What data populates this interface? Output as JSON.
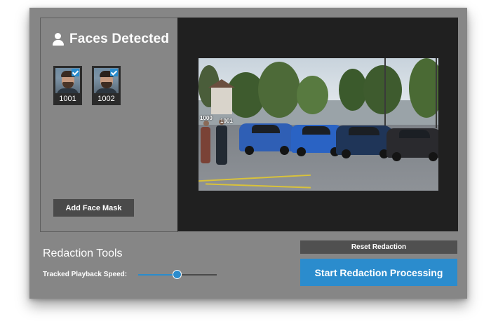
{
  "faces_panel": {
    "title": "Faces Detected",
    "faces": [
      {
        "id": "1001",
        "selected": true
      },
      {
        "id": "1002",
        "selected": true
      }
    ],
    "add_mask_label": "Add Face Mask"
  },
  "video": {
    "overlay_labels": [
      "1000",
      "1001"
    ]
  },
  "tools": {
    "title": "Redaction Tools",
    "speed_label": "Tracked Playback Speed:",
    "speed_value": 0.5,
    "reset_label": "Reset Redaction",
    "start_label": "Start Redaction Processing"
  },
  "colors": {
    "accent": "#2b8ccd",
    "panel_bg": "#868686",
    "video_bg": "#202020"
  },
  "icons": {
    "faces_header": "user-icon",
    "face_selected": "check-icon"
  }
}
